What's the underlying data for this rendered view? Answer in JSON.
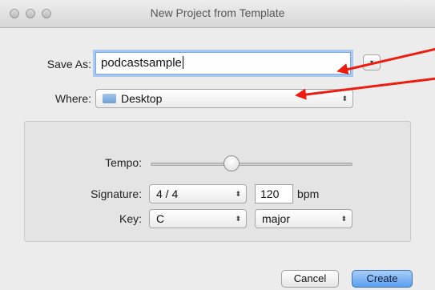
{
  "window": {
    "title": "New Project from Template"
  },
  "save_as": {
    "label": "Save As:",
    "value": "podcastsample",
    "expand_glyph": "▾"
  },
  "where": {
    "label": "Where:",
    "value": "Desktop",
    "arrows": "⬍"
  },
  "tempo": {
    "label": "Tempo:",
    "slider_fraction": 0.4,
    "bpm_value": "120",
    "bpm_unit": "bpm"
  },
  "signature": {
    "label": "Signature:",
    "value": "4 / 4",
    "arrows": "⬍"
  },
  "key": {
    "label": "Key:",
    "value": "C",
    "mode": "major",
    "arrows": "⬍"
  },
  "buttons": {
    "cancel": "Cancel",
    "create": "Create"
  },
  "colors": {
    "annotation_arrow": "#ee1c0f",
    "default_button": "#5b9ff0",
    "focus_ring": "#a9c9f3"
  }
}
